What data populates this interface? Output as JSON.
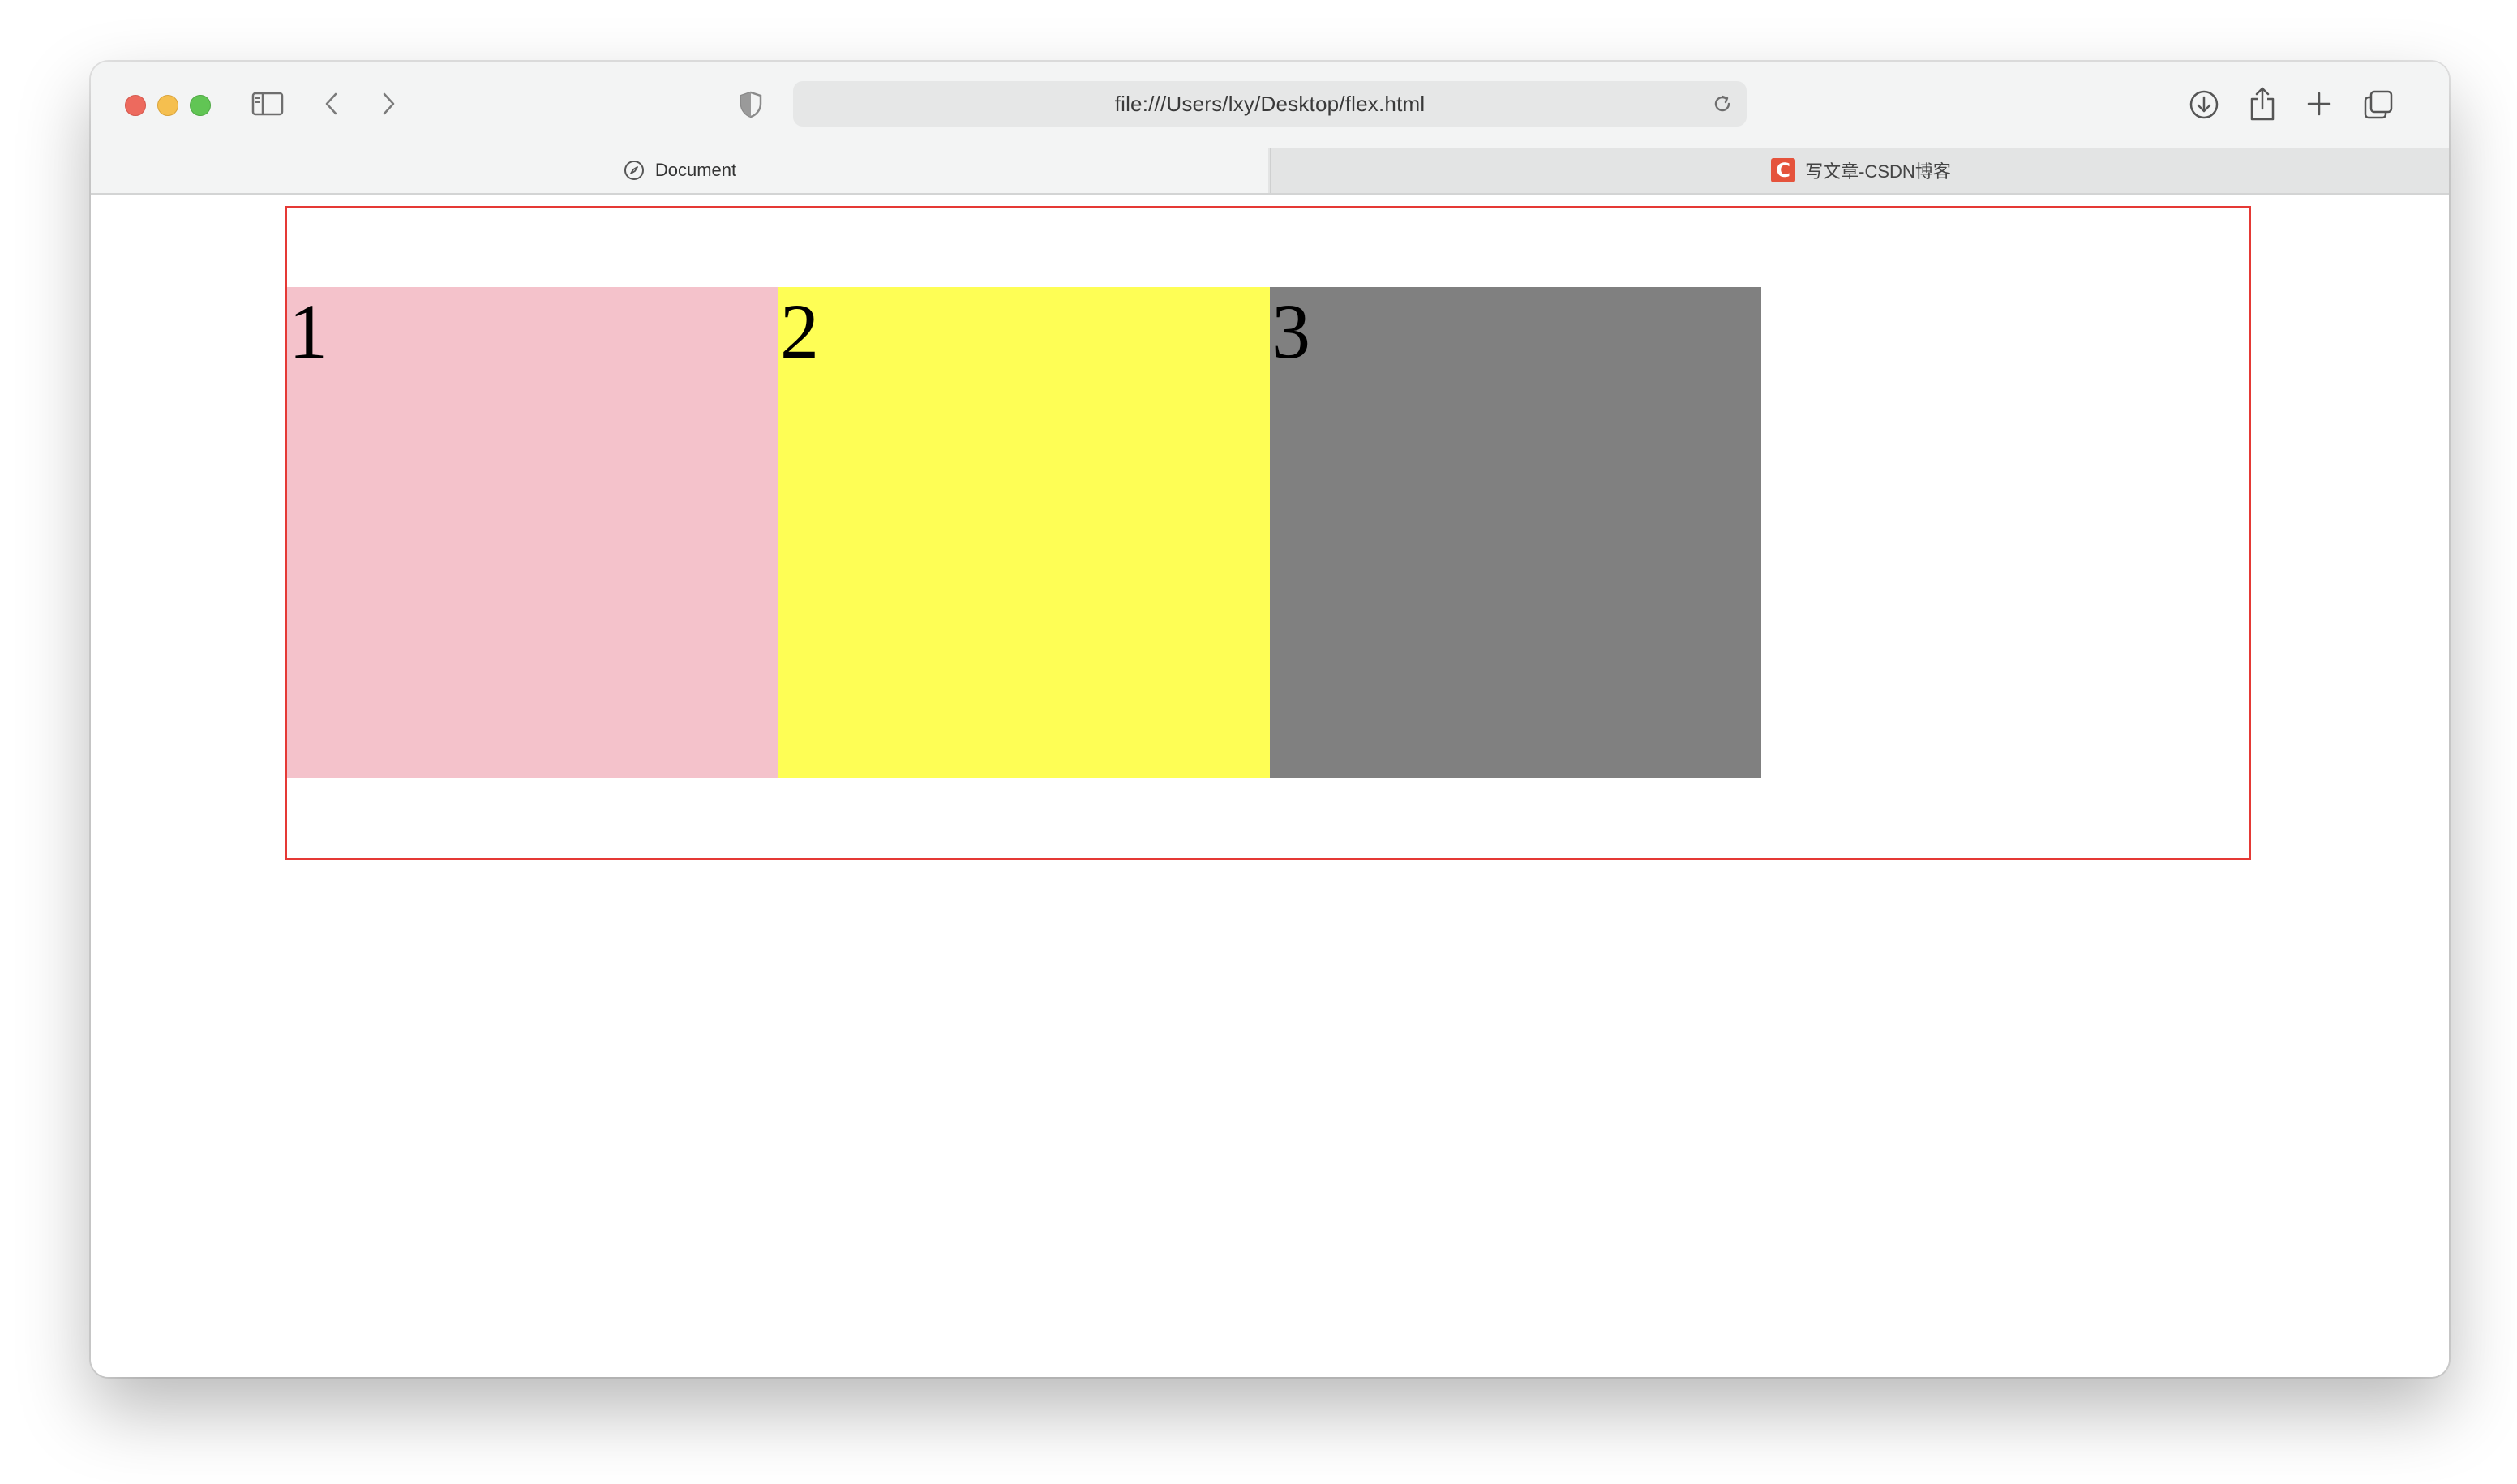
{
  "browser": {
    "url": "file:///Users/lxy/Desktop/flex.html",
    "tabs": [
      {
        "label": "Document",
        "icon": "compass-icon",
        "active": true
      },
      {
        "label": "写文章-CSDN博客",
        "icon": "csdn-icon",
        "icon_letter": "C",
        "active": false
      }
    ],
    "toolbar_icons": [
      "sidebar-icon",
      "back-icon",
      "forward-icon",
      "shield-icon",
      "reload-icon",
      "download-icon",
      "share-icon",
      "new-tab-icon",
      "tab-overview-icon"
    ]
  },
  "page": {
    "container_border_color": "#e53935",
    "items": [
      {
        "label": "1",
        "color": "#f4c2cb"
      },
      {
        "label": "2",
        "color": "#fefe55"
      },
      {
        "label": "3",
        "color": "#808080"
      }
    ]
  }
}
